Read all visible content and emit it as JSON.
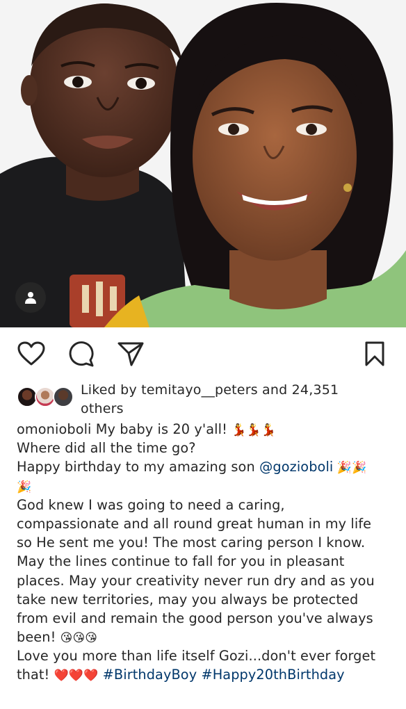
{
  "post": {
    "image_alt": "Photo of a smiling woman and a young boy",
    "tag_icon": "person-icon"
  },
  "actions": {
    "like_icon": "heart-icon",
    "comment_icon": "comment-icon",
    "share_icon": "paper-plane-icon",
    "save_icon": "bookmark-icon"
  },
  "likes": {
    "line1": "Liked by temitayo__peters and 24,351",
    "line2": "others"
  },
  "caption": {
    "username": "omonioboli",
    "l1_text": " My baby is 20 y'all! ",
    "l1_emoji": "💃💃💃",
    "l2": "Where did all the time go?",
    "l3_text": "Happy birthday to my amazing son ",
    "l3_mention": "@gozioboli",
    "l3_emoji": " 🎉🎉",
    "l4_emoji": "🎉",
    "l5": "God knew I was going to need a caring,",
    "l6": "compassionate and all round great human in my life",
    "l7": "so He sent me you! The most caring person I know.",
    "l8": "May the lines continue to fall for you in pleasant",
    "l9": "places. May your creativity never run dry and as you",
    "l10": "take new territories, may you always be protected",
    "l11": "from evil and remain the good person you've always",
    "l12_text": "been! ",
    "l12_emoji": "😘😘😘",
    "l13": "Love you more than life itself Gozi...don't ever forget",
    "l14_text": "that! ",
    "l14_emoji": "❤️❤️❤️",
    "l14_tags": " #BirthdayBoy #Happy20thBirthday"
  },
  "colors": {
    "text": "#262626",
    "link": "#00376b",
    "background": "#ffffff"
  }
}
